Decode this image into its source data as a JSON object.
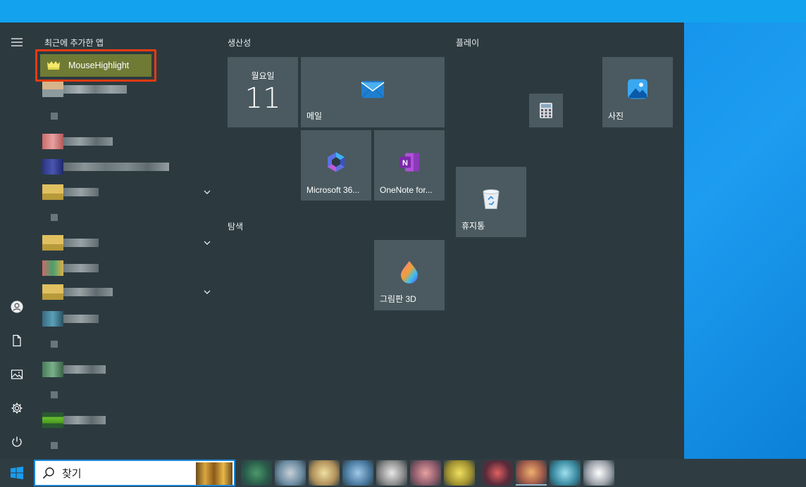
{
  "menu": {
    "recent_header": "최근에 추가한 앱",
    "recent_app": "MouseHighlight"
  },
  "groups": {
    "productivity": "생산성",
    "play": "플레이",
    "explore": "탐색"
  },
  "tiles": {
    "calendar_day": "월요일",
    "calendar_date": "11",
    "mail": "메일",
    "microsoft365": "Microsoft 36...",
    "onenote": "OneNote for...",
    "photos": "사진",
    "recycle_bin": "휴지통",
    "paint3d": "그림판 3D"
  },
  "rail": {
    "icons": [
      "hamburger-icon",
      "user-icon",
      "document-icon",
      "pictures-icon",
      "gear-icon",
      "power-icon"
    ]
  },
  "taskbar": {
    "search_text": "찾기"
  },
  "colors": {
    "menu_bg": "#2c3a40",
    "tile_bg": "#4a5a60",
    "highlight_border": "#e83a12",
    "highlight_fill": "#6f7a35",
    "desktop": "#1aa0ee"
  }
}
